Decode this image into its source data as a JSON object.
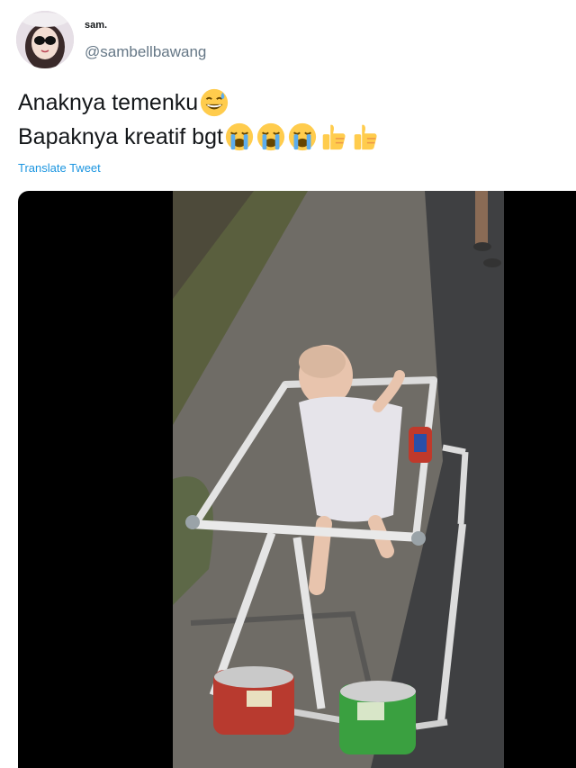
{
  "tweet": {
    "author_name": "sam.",
    "author_handle": "@sambellbawang",
    "text_line1": "Anaknya temenku",
    "text_line2": "Bapaknya kreatif bgt",
    "line1_emojis": [
      "sweat-smile-emoji"
    ],
    "line2_emojis": [
      "loudly-crying-emoji",
      "loudly-crying-emoji",
      "loudly-crying-emoji",
      "thumbs-up-emoji",
      "thumbs-up-emoji"
    ],
    "translate_label": "Translate Tweet"
  },
  "media": {
    "type": "video-still",
    "subject": "baby-walker-frame-photo"
  },
  "colors": {
    "text": "#14171a",
    "handle": "#657786",
    "link": "#1b95e0",
    "media_background": "#000000"
  }
}
